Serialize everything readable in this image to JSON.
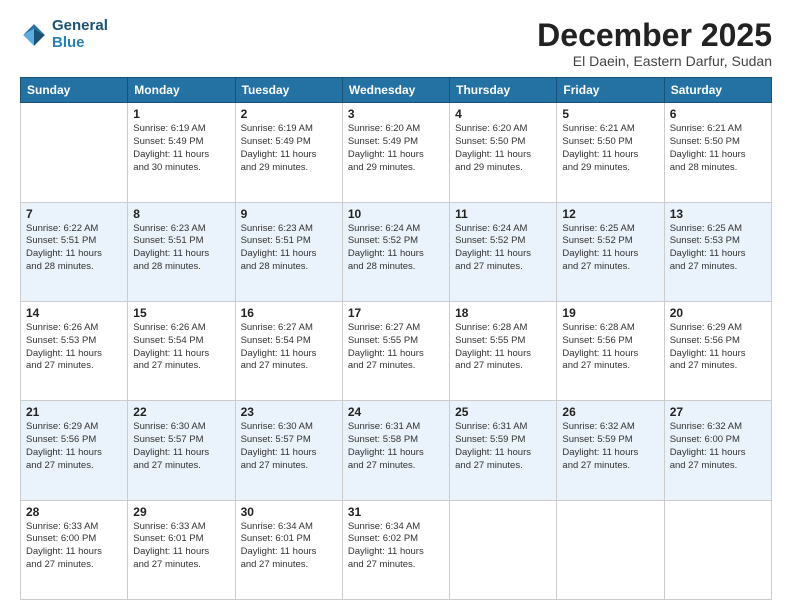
{
  "header": {
    "logo_line1": "General",
    "logo_line2": "Blue",
    "month": "December 2025",
    "location": "El Daein, Eastern Darfur, Sudan"
  },
  "weekdays": [
    "Sunday",
    "Monday",
    "Tuesday",
    "Wednesday",
    "Thursday",
    "Friday",
    "Saturday"
  ],
  "weeks": [
    [
      {
        "day": "",
        "info": ""
      },
      {
        "day": "1",
        "info": "Sunrise: 6:19 AM\nSunset: 5:49 PM\nDaylight: 11 hours\nand 30 minutes."
      },
      {
        "day": "2",
        "info": "Sunrise: 6:19 AM\nSunset: 5:49 PM\nDaylight: 11 hours\nand 29 minutes."
      },
      {
        "day": "3",
        "info": "Sunrise: 6:20 AM\nSunset: 5:49 PM\nDaylight: 11 hours\nand 29 minutes."
      },
      {
        "day": "4",
        "info": "Sunrise: 6:20 AM\nSunset: 5:50 PM\nDaylight: 11 hours\nand 29 minutes."
      },
      {
        "day": "5",
        "info": "Sunrise: 6:21 AM\nSunset: 5:50 PM\nDaylight: 11 hours\nand 29 minutes."
      },
      {
        "day": "6",
        "info": "Sunrise: 6:21 AM\nSunset: 5:50 PM\nDaylight: 11 hours\nand 28 minutes."
      }
    ],
    [
      {
        "day": "7",
        "info": "Sunrise: 6:22 AM\nSunset: 5:51 PM\nDaylight: 11 hours\nand 28 minutes."
      },
      {
        "day": "8",
        "info": "Sunrise: 6:23 AM\nSunset: 5:51 PM\nDaylight: 11 hours\nand 28 minutes."
      },
      {
        "day": "9",
        "info": "Sunrise: 6:23 AM\nSunset: 5:51 PM\nDaylight: 11 hours\nand 28 minutes."
      },
      {
        "day": "10",
        "info": "Sunrise: 6:24 AM\nSunset: 5:52 PM\nDaylight: 11 hours\nand 28 minutes."
      },
      {
        "day": "11",
        "info": "Sunrise: 6:24 AM\nSunset: 5:52 PM\nDaylight: 11 hours\nand 27 minutes."
      },
      {
        "day": "12",
        "info": "Sunrise: 6:25 AM\nSunset: 5:52 PM\nDaylight: 11 hours\nand 27 minutes."
      },
      {
        "day": "13",
        "info": "Sunrise: 6:25 AM\nSunset: 5:53 PM\nDaylight: 11 hours\nand 27 minutes."
      }
    ],
    [
      {
        "day": "14",
        "info": "Sunrise: 6:26 AM\nSunset: 5:53 PM\nDaylight: 11 hours\nand 27 minutes."
      },
      {
        "day": "15",
        "info": "Sunrise: 6:26 AM\nSunset: 5:54 PM\nDaylight: 11 hours\nand 27 minutes."
      },
      {
        "day": "16",
        "info": "Sunrise: 6:27 AM\nSunset: 5:54 PM\nDaylight: 11 hours\nand 27 minutes."
      },
      {
        "day": "17",
        "info": "Sunrise: 6:27 AM\nSunset: 5:55 PM\nDaylight: 11 hours\nand 27 minutes."
      },
      {
        "day": "18",
        "info": "Sunrise: 6:28 AM\nSunset: 5:55 PM\nDaylight: 11 hours\nand 27 minutes."
      },
      {
        "day": "19",
        "info": "Sunrise: 6:28 AM\nSunset: 5:56 PM\nDaylight: 11 hours\nand 27 minutes."
      },
      {
        "day": "20",
        "info": "Sunrise: 6:29 AM\nSunset: 5:56 PM\nDaylight: 11 hours\nand 27 minutes."
      }
    ],
    [
      {
        "day": "21",
        "info": "Sunrise: 6:29 AM\nSunset: 5:56 PM\nDaylight: 11 hours\nand 27 minutes."
      },
      {
        "day": "22",
        "info": "Sunrise: 6:30 AM\nSunset: 5:57 PM\nDaylight: 11 hours\nand 27 minutes."
      },
      {
        "day": "23",
        "info": "Sunrise: 6:30 AM\nSunset: 5:57 PM\nDaylight: 11 hours\nand 27 minutes."
      },
      {
        "day": "24",
        "info": "Sunrise: 6:31 AM\nSunset: 5:58 PM\nDaylight: 11 hours\nand 27 minutes."
      },
      {
        "day": "25",
        "info": "Sunrise: 6:31 AM\nSunset: 5:59 PM\nDaylight: 11 hours\nand 27 minutes."
      },
      {
        "day": "26",
        "info": "Sunrise: 6:32 AM\nSunset: 5:59 PM\nDaylight: 11 hours\nand 27 minutes."
      },
      {
        "day": "27",
        "info": "Sunrise: 6:32 AM\nSunset: 6:00 PM\nDaylight: 11 hours\nand 27 minutes."
      }
    ],
    [
      {
        "day": "28",
        "info": "Sunrise: 6:33 AM\nSunset: 6:00 PM\nDaylight: 11 hours\nand 27 minutes."
      },
      {
        "day": "29",
        "info": "Sunrise: 6:33 AM\nSunset: 6:01 PM\nDaylight: 11 hours\nand 27 minutes."
      },
      {
        "day": "30",
        "info": "Sunrise: 6:34 AM\nSunset: 6:01 PM\nDaylight: 11 hours\nand 27 minutes."
      },
      {
        "day": "31",
        "info": "Sunrise: 6:34 AM\nSunset: 6:02 PM\nDaylight: 11 hours\nand 27 minutes."
      },
      {
        "day": "",
        "info": ""
      },
      {
        "day": "",
        "info": ""
      },
      {
        "day": "",
        "info": ""
      }
    ]
  ]
}
